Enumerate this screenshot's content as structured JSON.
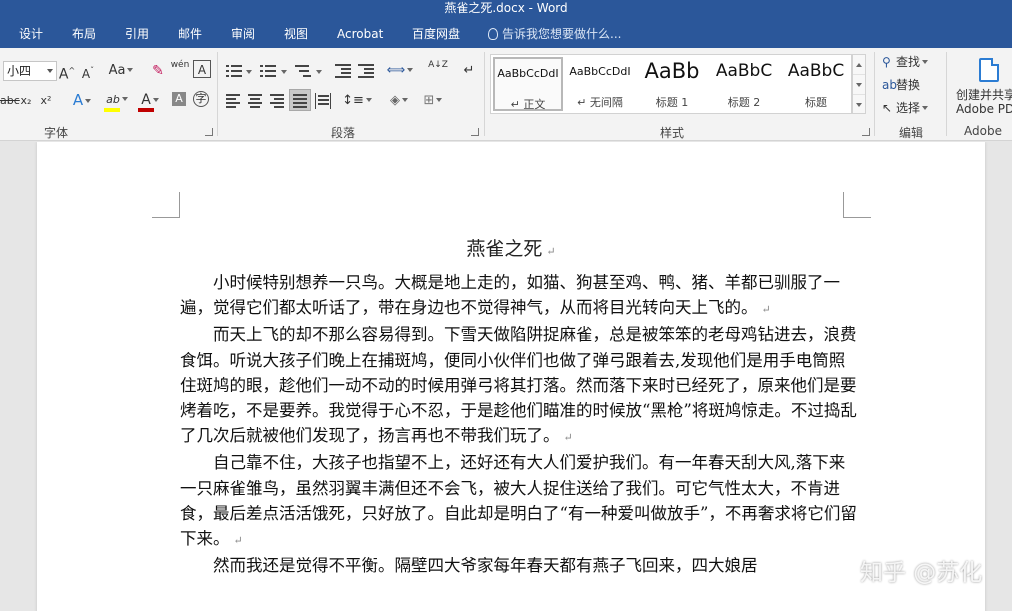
{
  "window": {
    "title": "燕雀之死.docx - Word"
  },
  "tabs": [
    "设计",
    "布局",
    "引用",
    "邮件",
    "审阅",
    "视图",
    "Acrobat",
    "百度网盘"
  ],
  "tell_me": {
    "placeholder": "告诉我您想要做什么..."
  },
  "ribbon": {
    "font": {
      "group_label": "字体",
      "font_size": "小四",
      "grow_label": "A",
      "shrink_label": "A",
      "case_label": "Aa",
      "phonetic_label": "wén",
      "border_label": "A",
      "strike_label": "abc",
      "subscript_label": "x₂",
      "superscript_label": "x²",
      "effects_label": "A",
      "highlight_label": "ab",
      "color_label": "A",
      "shading_label": "A",
      "enclose_label": "字",
      "font_color": "#c00000",
      "highlight_color": "#ffff00"
    },
    "paragraph": {
      "group_label": "段落",
      "sort_label": "A↓Z",
      "show_marks_label": "↵"
    },
    "styles": {
      "group_label": "样式",
      "items": [
        {
          "preview": "AaBbCcDdI",
          "name": "↵ 正文"
        },
        {
          "preview": "AaBbCcDdI",
          "name": "↵ 无间隔"
        },
        {
          "preview": "AaBb",
          "name": "标题 1"
        },
        {
          "preview": "AaBbC",
          "name": "标题 2"
        },
        {
          "preview": "AaBbC",
          "name": "标题"
        }
      ]
    },
    "editing": {
      "group_label": "编辑",
      "find": "查找",
      "replace": "替换",
      "select": "选择"
    },
    "adobe": {
      "group_label": "Adobe",
      "button_line1": "创建并共享",
      "button_line2": "Adobe PDF"
    }
  },
  "document": {
    "title": "燕雀之死",
    "lines": [
      "小时候特别想养一只鸟。大概是地上走的，如猫、狗甚至鸡、鸭、猪、羊都",
      "已驯服了一遍，觉得它们都太听话了，带在身边也不觉得神气，从而将目光转向",
      "天上飞的。",
      "而天上飞的却不那么容易得到。下雪天做陷阱捉麻雀，总是被笨笨的老母鸡",
      "钻进去，浪费食饵。听说大孩子们晚上在捕斑鸠，便同小伙伴们也做了弹弓跟着",
      "去,发现他们是用手电筒照住斑鸠的眼，趁他们一动不动的时候用弹弓将其打落。",
      "然而落下来时已经死了，原来他们是要烤着吃，不是要养。我觉得于心不忍，于",
      "是趁他们瞄准的时候放“黑枪”将斑鸠惊走。不过捣乱了几次后就被他们发现了，",
      "扬言再也不带我们玩了。",
      "自己靠不住，大孩子也指望不上，还好还有大人们爱护我们。有一年春天刮",
      "大风,落下来一只麻雀雏鸟，虽然羽翼丰满但还不会飞，被大人捉住送给了我们。",
      "可它气性太大，不肯进食，最后差点活活饿死，只好放了。自此却是明白了“有",
      "一种爱叫做放手”，不再奢求将它们留下来。",
      "然而我还是觉得不平衡。隔壁四大爷家每年春天都有燕子飞回来，四大娘居"
    ],
    "paragraph_mark": "↵"
  },
  "watermark": "知乎 @苏化"
}
